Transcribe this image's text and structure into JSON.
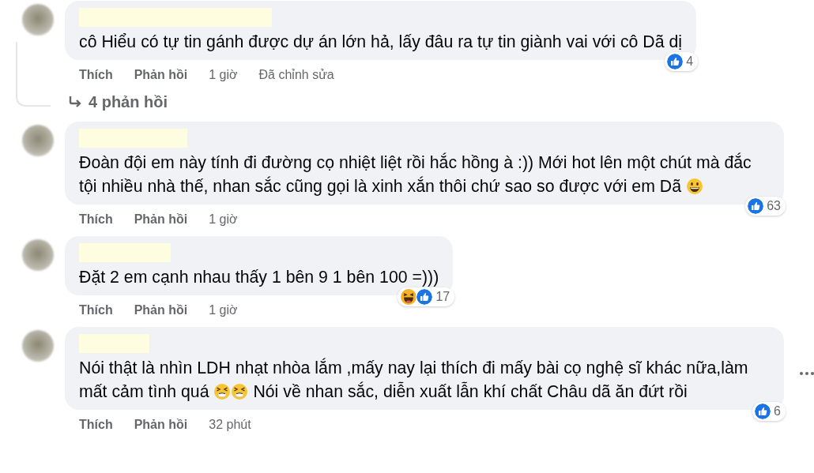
{
  "comments": [
    {
      "text": [
        {
          "kind": "text",
          "value": "cô Hiểu có tự tin gánh được dự án lớn hả, lấy đâu ra tự tin giành vai với cô Dã dị"
        }
      ],
      "reactions": [
        {
          "kind": "like"
        }
      ],
      "reaction_count": "4",
      "like": "Thích",
      "reply": "Phản hồi",
      "time": "1 giờ",
      "edited": "Đã chỉnh sửa",
      "replies": "4 phản hồi",
      "menu_button": false
    },
    {
      "text": [
        {
          "kind": "text",
          "value": "Đoàn đội em này tính đi đường cọ nhiệt liệt rồi hắc hồng à :)) Mới hot lên một chút mà đắc tội nhiều nhà thế, nhan sắc cũng gọi là xinh xắn thôi chứ sao so được với em Dã "
        },
        {
          "kind": "grin"
        }
      ],
      "reactions": [
        {
          "kind": "like"
        }
      ],
      "reaction_count": "63",
      "like": "Thích",
      "reply": "Phản hồi",
      "time": "1 giờ",
      "menu_button": false
    },
    {
      "text": [
        {
          "kind": "text",
          "value": "Đặt 2 em cạnh nhau thấy 1 bên 9 1 bên 100 =)))"
        }
      ],
      "reactions": [
        {
          "kind": "haha"
        },
        {
          "kind": "like"
        }
      ],
      "reaction_count": "17",
      "like": "Thích",
      "reply": "Phản hồi",
      "time": "1 giờ",
      "menu_button": false
    },
    {
      "text": [
        {
          "kind": "text",
          "value": "Nói thật là nhìn LDH nhạt nhòa lắm ,mấy nay lại thích đi mấy bài cọ nghệ sĩ khác nữa,làm mất cảm tình quá "
        },
        {
          "kind": "sneeze"
        },
        {
          "kind": "sneeze"
        },
        {
          "kind": "text",
          "value": " Nói về nhan sắc, diễn xuất lẫn khí chất Châu dã ăn đứt rồi"
        }
      ],
      "reactions": [
        {
          "kind": "like"
        }
      ],
      "reaction_count": "6",
      "like": "Thích",
      "reply": "Phản hồi",
      "time": "32 phút",
      "menu_button": true
    }
  ]
}
